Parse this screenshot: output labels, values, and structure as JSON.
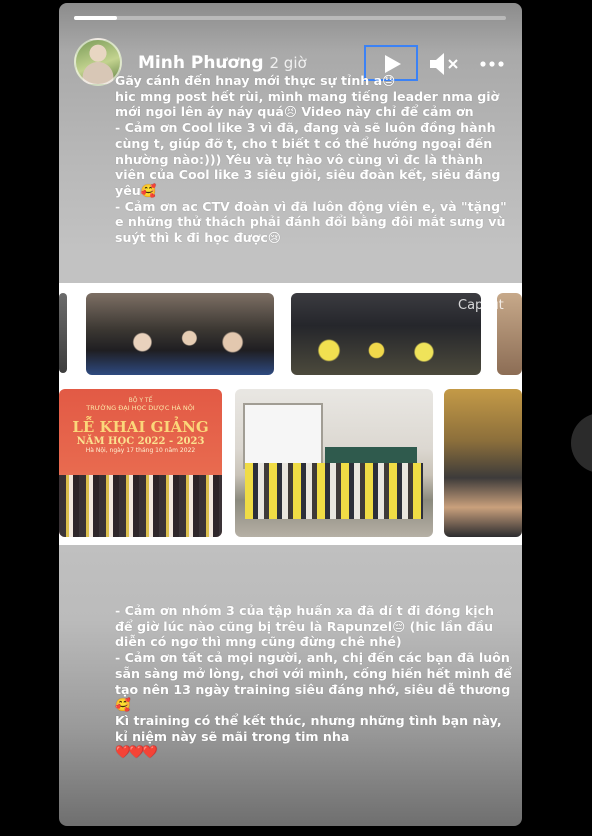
{
  "story": {
    "progress": 0.1,
    "author": "Minh Phương",
    "time": "2 giờ",
    "caption_top": [
      "Gãy cánh đến hnay mới thực sự tỉnh a😓",
      "hic mng post hết rùi, mình mang tiếng leader nma giờ",
      "mới ngoi lên áy náy quá😣 Video này chỉ để cảm ơn",
      "- Cảm ơn Cool like 3 vì đã, đang và sẽ luôn đồng hành",
      "cùng t, giúp đỡ t, cho t biết t có thể hướng ngoại đến",
      "nhường nào:))) Yêu và tự hào vô cùng vì đc là thành",
      "viên của Cool like 3 siêu giỏi, siêu đoàn kết, siêu đáng",
      "yêu🥰",
      "- Cảm ơn ac CTV đoàn vì đã luôn động viên e, và \"tặng\"",
      "e những thử thách phải đánh đổi bằng đôi mắt sưng vù",
      "suýt thì k đi học được😢"
    ],
    "caption_bottom": [
      "- Cảm ơn nhóm 3 của tập huấn xa đã dí t đi đóng kịch",
      "để giờ lúc nào cũng bị trêu là Rapunzel😔 (hic lần đầu",
      "diễn có ngơ thì mng cũng đừng chê nhé)",
      "- Cảm ơn tất cả mọi người, anh, chị đến các bạn đã luôn",
      "sẵn sàng mở lòng, chơi với mình, cống hiến hết mình để",
      "tạo nên 13 ngày training siêu đáng nhớ, siêu dễ thương",
      "🥰",
      "Kì training có thể kết thúc, nhưng những tình bạn này,",
      "kỉ niệm này sẽ mãi trong tim nha",
      "❤️❤️❤️"
    ],
    "watermark": "Capcut",
    "banner": {
      "line1": "BỘ Y TẾ",
      "line2": "TRƯỜNG ĐẠI HỌC DƯỢC HÀ NỘI",
      "line3": "LỄ KHAI GIẢNG",
      "line4": "NĂM HỌC 2022 - 2023",
      "line5": "Hà Nội, ngày 17 tháng 10 năm 2022"
    }
  },
  "icons": {
    "play": "play-icon",
    "mute": "speaker-muted-icon",
    "more": "more-horizontal-icon"
  },
  "colors": {
    "focus_outline": "#3b82f6",
    "heart": "#c0182a"
  }
}
